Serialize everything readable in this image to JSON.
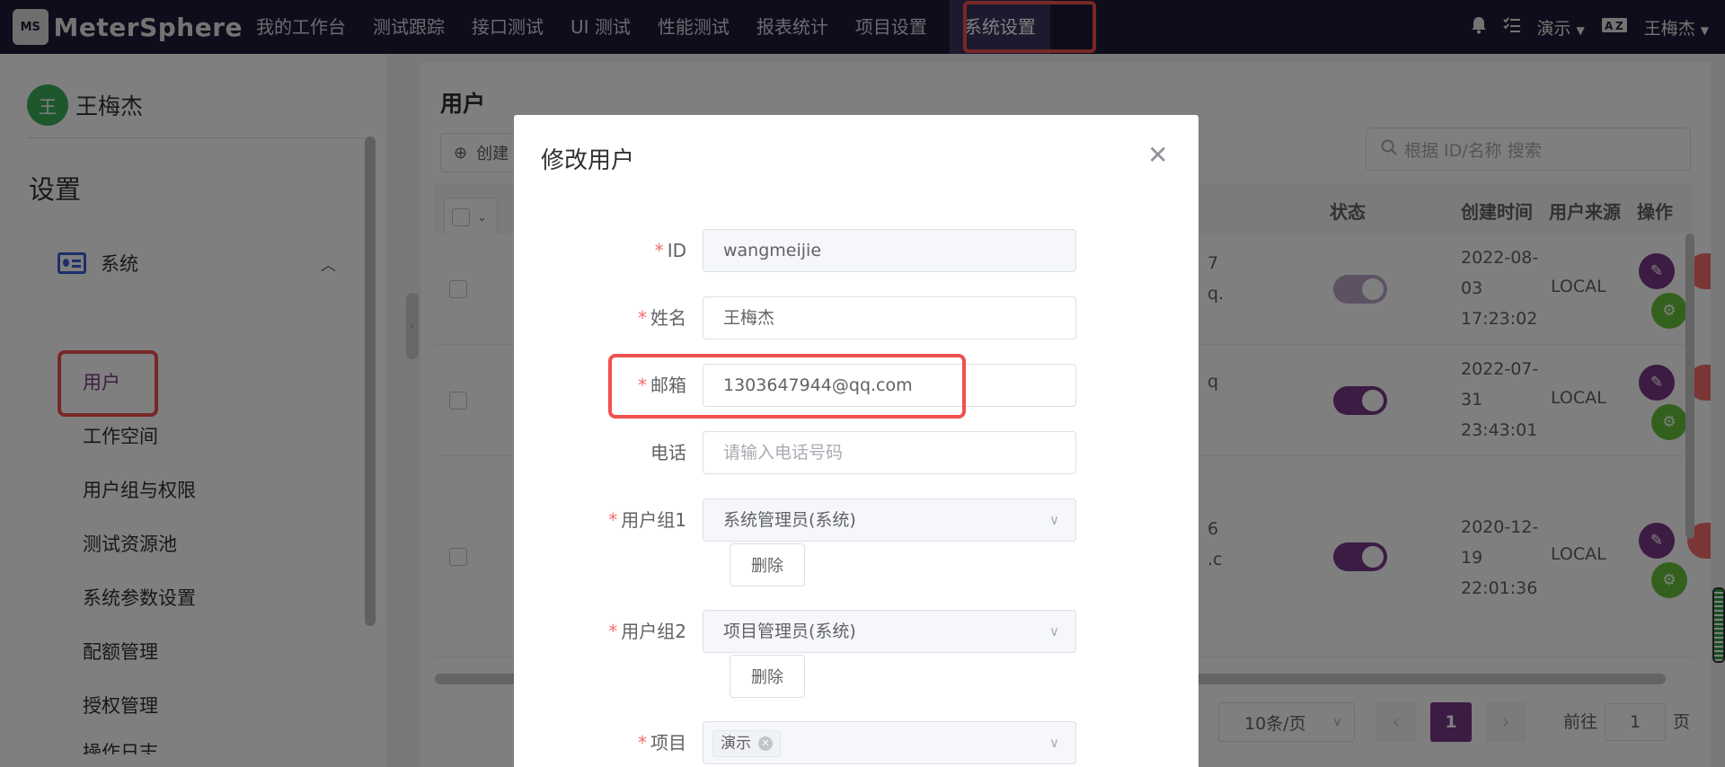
{
  "app": {
    "logo_mark": "MS",
    "brand": "MeterSphere"
  },
  "topnav": [
    {
      "label": "我的工作台"
    },
    {
      "label": "测试跟踪"
    },
    {
      "label": "接口测试"
    },
    {
      "label": "UI 测试"
    },
    {
      "label": "性能测试"
    },
    {
      "label": "报表统计"
    },
    {
      "label": "项目设置"
    },
    {
      "label": "系统设置",
      "active": true
    }
  ],
  "topright": {
    "bell_icon": "bell-icon",
    "task_icon": "task-list-icon",
    "workspace": "演示",
    "language_icon": "language-icon",
    "user": "王梅杰"
  },
  "sidebar": {
    "avatar": "王",
    "user_name": "王梅杰",
    "title": "设置",
    "group": {
      "label": "系统",
      "icon": "system-card-icon"
    },
    "items": [
      {
        "label": "用户",
        "active": true
      },
      {
        "label": "工作空间"
      },
      {
        "label": "用户组与权限"
      },
      {
        "label": "测试资源池"
      },
      {
        "label": "系统参数设置"
      },
      {
        "label": "配额管理"
      },
      {
        "label": "授权管理"
      },
      {
        "label": "操作日志"
      }
    ]
  },
  "main": {
    "title": "用户",
    "create_label": "创建",
    "search_placeholder": "根据 ID/名称 搜索",
    "columns": {
      "status": "状态",
      "created": "创建时间",
      "source": "用户来源",
      "actions": "操作"
    },
    "rows": [
      {
        "email_fragment": "7\nq.",
        "enabled": false,
        "created": "2022-08-03 17:23:02",
        "source": "LOCAL"
      },
      {
        "email_fragment": "q",
        "enabled": true,
        "created": "2022-07-31 23:43:01",
        "source": "LOCAL"
      },
      {
        "email_fragment": "6\n.c",
        "enabled": true,
        "created": "2020-12-19 22:01:36",
        "source": "LOCAL"
      }
    ],
    "pagination": {
      "page_size": "10条/页",
      "current_page": "1",
      "goto_prefix": "前往",
      "goto_value": "1",
      "goto_suffix": "页"
    }
  },
  "modal": {
    "title": "修改用户",
    "fields": {
      "id": {
        "label": "ID",
        "value": "wangmeijie",
        "required": true
      },
      "name": {
        "label": "姓名",
        "value": "王梅杰",
        "required": true
      },
      "email": {
        "label": "邮箱",
        "value": "1303647944@qq.com",
        "required": true
      },
      "phone": {
        "label": "电话",
        "placeholder": "请输入电话号码",
        "required": false
      },
      "group1": {
        "label": "用户组1",
        "value": "系统管理员(系统)",
        "required": true
      },
      "group2": {
        "label": "用户组2",
        "value": "项目管理员(系统)",
        "required": true
      },
      "project": {
        "label": "项目",
        "tag": "演示",
        "required": true
      }
    },
    "delete_label": "删除",
    "required_mark": "*"
  },
  "colors": {
    "primary": "#783887",
    "topbar": "#1e1b37",
    "highlight": "#f0504f",
    "success": "#67c23a",
    "danger": "#f56c6c"
  }
}
